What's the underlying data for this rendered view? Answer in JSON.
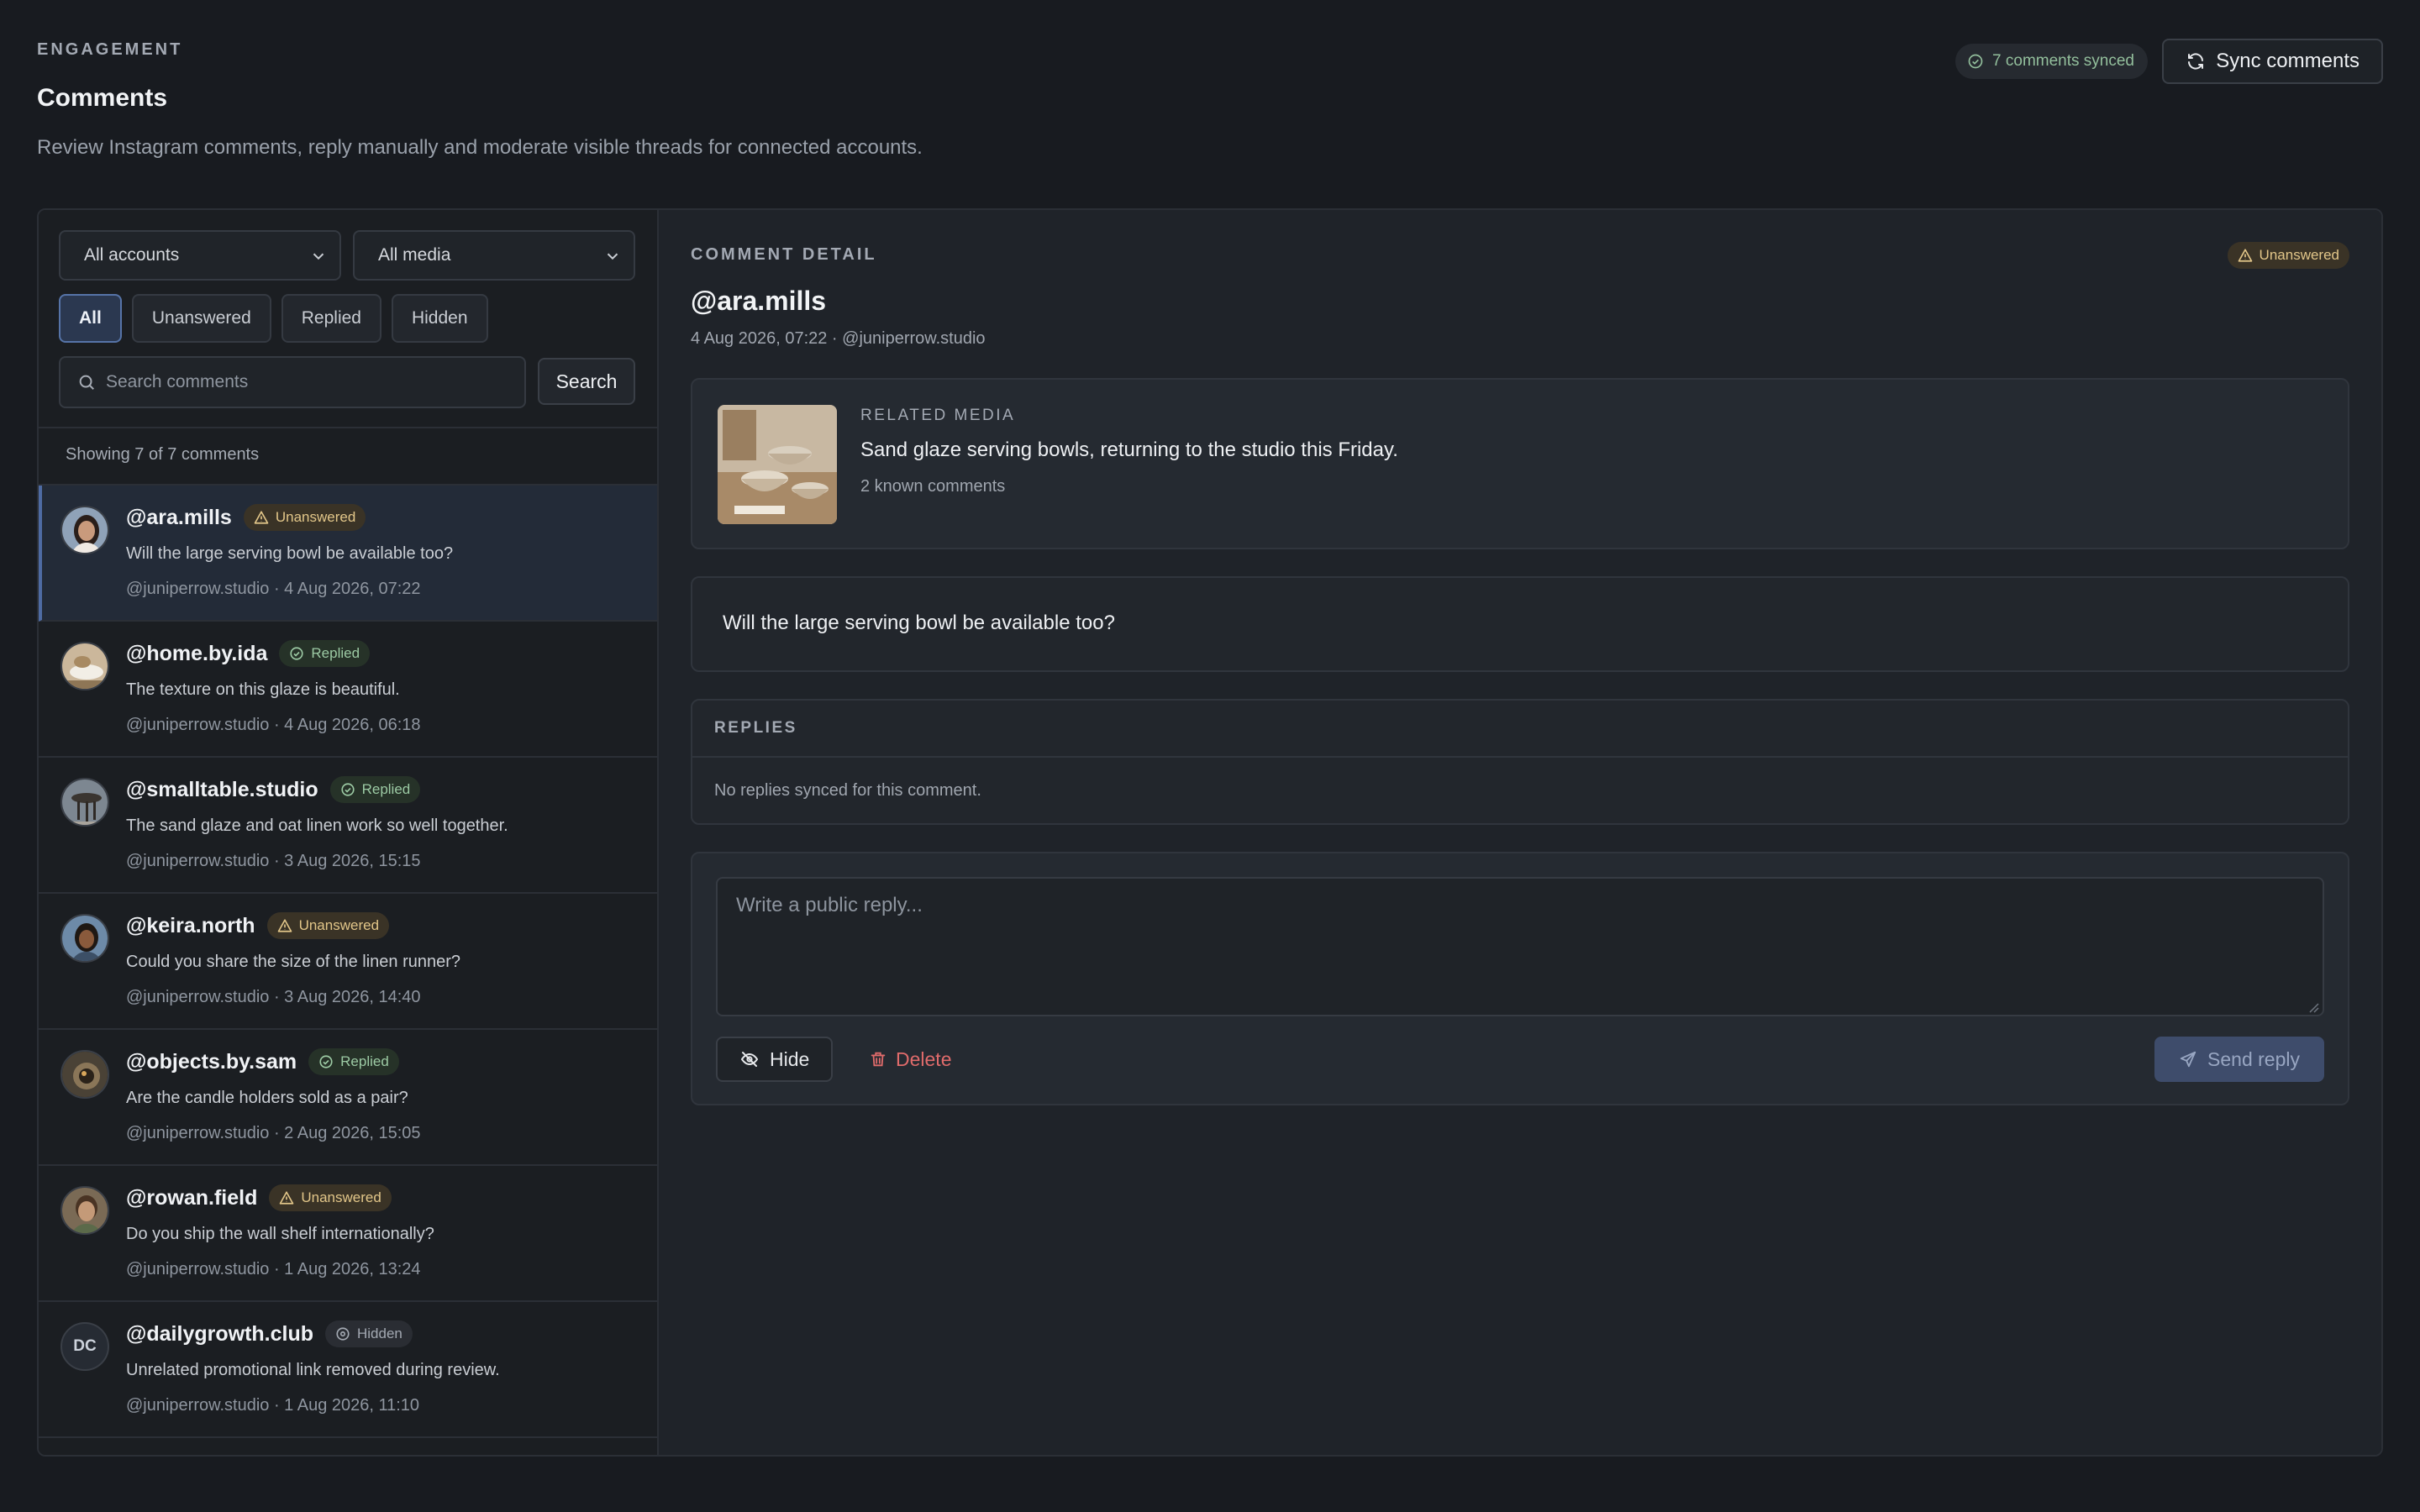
{
  "header": {
    "eyebrow": "ENGAGEMENT",
    "title": "Comments",
    "subtitle": "Review Instagram comments, reply manually and moderate visible threads for connected accounts.",
    "sync_status": "7 comments synced",
    "sync_button": "Sync comments"
  },
  "filters": {
    "account_select": "All accounts",
    "media_select": "All media",
    "tabs": [
      {
        "label": "All",
        "active": true
      },
      {
        "label": "Unanswered",
        "active": false
      },
      {
        "label": "Replied",
        "active": false
      },
      {
        "label": "Hidden",
        "active": false
      }
    ],
    "search_placeholder": "Search comments",
    "search_button": "Search",
    "showing_text": "Showing 7 of 7 comments"
  },
  "comments": [
    {
      "handle": "@ara.mills",
      "status": "Unanswered",
      "text": "Will the large serving bowl be available too?",
      "meta": "@juniperrow.studio · 4 Aug 2026, 07:22",
      "avatar": "photo"
    },
    {
      "handle": "@home.by.ida",
      "status": "Replied",
      "text": "The texture on this glaze is beautiful.",
      "meta": "@juniperrow.studio · 4 Aug 2026, 06:18",
      "avatar": "photo"
    },
    {
      "handle": "@smalltable.studio",
      "status": "Replied",
      "text": "The sand glaze and oat linen work so well together.",
      "meta": "@juniperrow.studio · 3 Aug 2026, 15:15",
      "avatar": "photo"
    },
    {
      "handle": "@keira.north",
      "status": "Unanswered",
      "text": "Could you share the size of the linen runner?",
      "meta": "@juniperrow.studio · 3 Aug 2026, 14:40",
      "avatar": "photo"
    },
    {
      "handle": "@objects.by.sam",
      "status": "Replied",
      "text": "Are the candle holders sold as a pair?",
      "meta": "@juniperrow.studio · 2 Aug 2026, 15:05",
      "avatar": "photo"
    },
    {
      "handle": "@rowan.field",
      "status": "Unanswered",
      "text": "Do you ship the wall shelf internationally?",
      "meta": "@juniperrow.studio · 1 Aug 2026, 13:24",
      "avatar": "photo"
    },
    {
      "handle": "@dailygrowth.club",
      "status": "Hidden",
      "text": "Unrelated promotional link removed during review.",
      "meta": "@juniperrow.studio · 1 Aug 2026, 11:10",
      "avatar": "initials",
      "initials": "DC"
    }
  ],
  "detail": {
    "eyebrow": "COMMENT DETAIL",
    "status": "Unanswered",
    "handle": "@ara.mills",
    "meta": "4 Aug 2026, 07:22 · @juniperrow.studio",
    "media_eyebrow": "RELATED MEDIA",
    "media_title": "Sand glaze serving bowls, returning to the studio this Friday.",
    "media_count": "2 known comments",
    "comment_text": "Will the large serving bowl be available too?",
    "replies_title": "REPLIES",
    "replies_empty": "No replies synced for this comment.",
    "reply_placeholder": "Write a public reply...",
    "hide_button": "Hide",
    "delete_button": "Delete",
    "send_button": "Send reply"
  },
  "colors": {
    "background": "#181b20",
    "accent": "#4e6ba3",
    "unanswered": "#e2c689",
    "replied": "#9ccaa4",
    "danger": "#e06b6b"
  }
}
